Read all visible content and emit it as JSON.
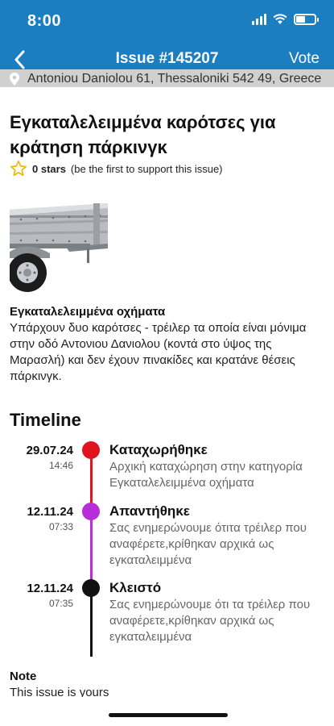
{
  "status_bar": {
    "time": "8:00",
    "battery_level": 0.5
  },
  "nav": {
    "title": "Issue #145207",
    "vote_label": "Vote",
    "back_icon": "chevron-left-icon"
  },
  "address": {
    "text": "Antoniou Daniolou 61, Thessaloniki 542 49, Greece",
    "icon": "location-pin-icon"
  },
  "issue": {
    "title": "Εγκαταλελειμμένα καρότσες για κράτηση πάρκινγκ",
    "stars_count": "0 stars",
    "stars_note": "(be the first to support this issue)",
    "category": "Εγκαταλελειμμένα οχήματα",
    "description": "Υπάρχουν δυο καρότσες - τρέιλερ τα οποία είναι μόνιμα στην οδό Αντονιου Δανιολου (κοντά στο ύψος της Μαρασλή) και δεν έχουν πινακίδες και κρατάνε θέσεις πάρκινγκ."
  },
  "timeline": {
    "heading": "Timeline",
    "entries": [
      {
        "date": "29.07.24",
        "time": "14:46",
        "status": "Καταχωρήθηκε",
        "note": "Αρχική καταχώρηση στην κατηγορία Εγκαταλελειμμένα οχήματα",
        "color": "#e0141e"
      },
      {
        "date": "12.11.24",
        "time": "07:33",
        "status": "Απαντήθηκε",
        "note": "Σας ενημερώνουμε ότιτα τρέιλερ που αναφέρετε,κρίθηκαν αρχικά ως εγκαταλειμμένα",
        "color": "#b52ed8"
      },
      {
        "date": "12.11.24",
        "time": "07:35",
        "status": "Κλειστό",
        "note": "Σας ενημερώνουμε ότι τα τρέιλερ που αναφέρετε,κρίθηκαν αρχικά ως εγκαταλειμμένα",
        "color": "#111111"
      }
    ]
  },
  "note": {
    "label": "Note",
    "text": "This issue is yours"
  },
  "colors": {
    "brand": "#1a7ec0",
    "star": "#f2b600"
  }
}
